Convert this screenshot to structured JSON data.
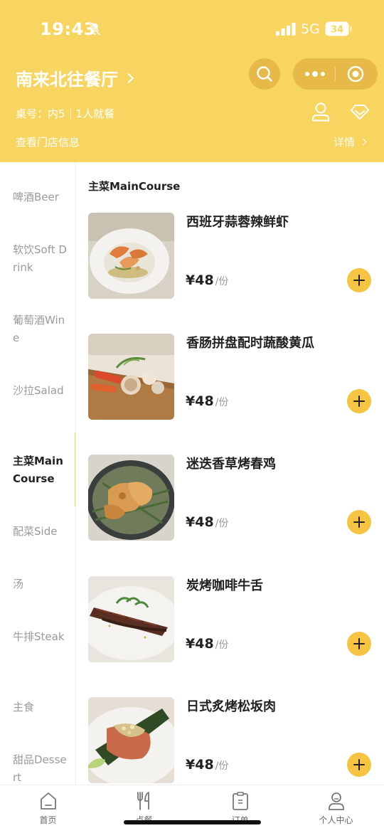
{
  "status": {
    "time": "19:43",
    "network": "5G",
    "battery": "34"
  },
  "header": {
    "store_name": "南来北往餐厅",
    "table_label": "桌号：内5",
    "diners_label": "1人就餐",
    "store_info_label": "查看门店信息",
    "details_label": "详情"
  },
  "sidebar": {
    "categories": [
      {
        "label": "啤酒Beer"
      },
      {
        "label": "软饮Soft Drink"
      },
      {
        "label": "葡萄酒Wine"
      },
      {
        "label": "沙拉Salad"
      },
      {
        "label": "主菜MainCourse"
      },
      {
        "label": "配菜Side"
      },
      {
        "label": "汤"
      },
      {
        "label": "牛排Steak"
      },
      {
        "label": "主食"
      },
      {
        "label": "甜品Dessert"
      }
    ],
    "active": "主菜MainCourse"
  },
  "menu": {
    "section_title": "主菜MainCourse",
    "items": [
      {
        "name": "西班牙蒜蓉辣鲜虾",
        "price": "¥48",
        "unit": "/份"
      },
      {
        "name": "香肠拼盘配时蔬酸黄瓜",
        "price": "¥48",
        "unit": "/份"
      },
      {
        "name": "迷迭香草烤春鸡",
        "price": "¥48",
        "unit": "/份"
      },
      {
        "name": "炭烤咖啡牛舌",
        "price": "¥48",
        "unit": "/份"
      },
      {
        "name": "日式炙烤松坂肉",
        "price": "¥48",
        "unit": "/份"
      }
    ]
  },
  "tabbar": {
    "tabs": [
      {
        "label": "首页",
        "icon": "home-icon"
      },
      {
        "label": "点餐",
        "icon": "fork-knife-icon"
      },
      {
        "label": "订单",
        "icon": "clipboard-icon"
      },
      {
        "label": "个人中心",
        "icon": "person-icon"
      }
    ]
  },
  "colors": {
    "brand": "#F8D561",
    "add_button": "#F5C443",
    "accent_dark": "#E6B948"
  }
}
